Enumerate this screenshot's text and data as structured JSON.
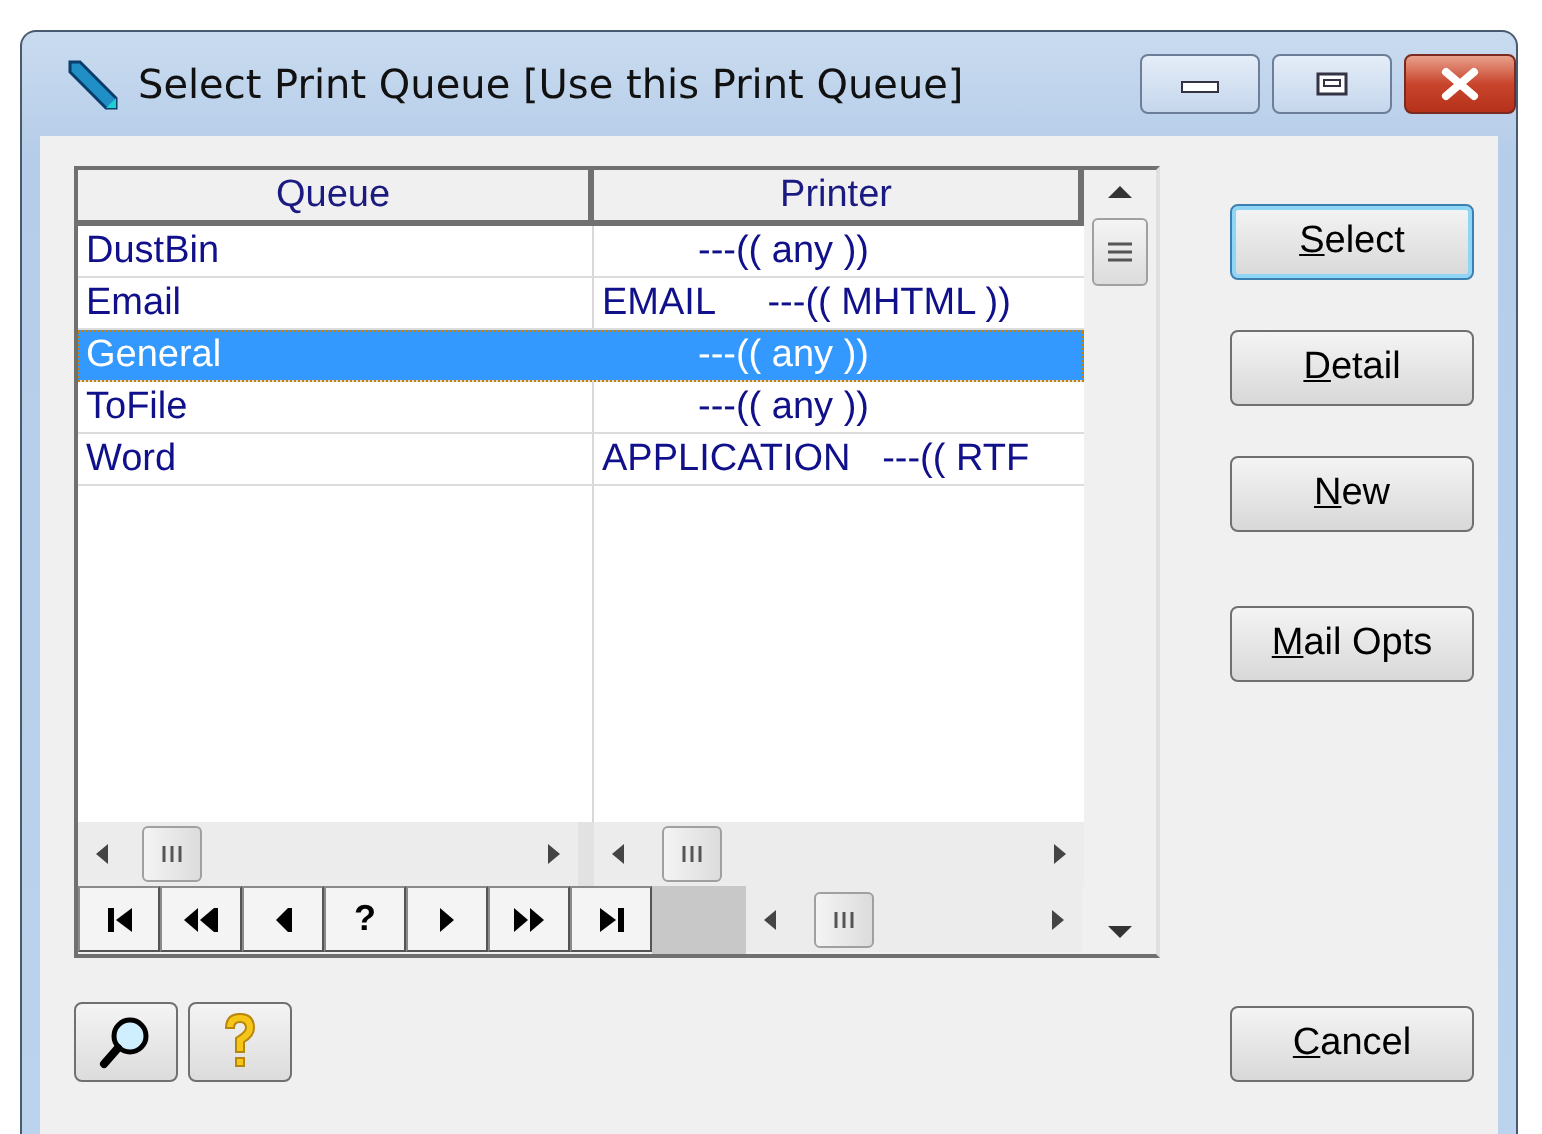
{
  "window": {
    "title": "Select Print Queue [Use this Print Queue]"
  },
  "table": {
    "columns": [
      "Queue",
      "Printer"
    ],
    "rows": [
      {
        "queue": "DustBin",
        "printer": "---(( any ))",
        "selected": false
      },
      {
        "queue": "Email",
        "printer": "EMAIL     ---(( MHTML ))",
        "selected": false
      },
      {
        "queue": "General",
        "printer": "---(( any ))",
        "selected": true
      },
      {
        "queue": "ToFile",
        "printer": "---(( any ))",
        "selected": false
      },
      {
        "queue": "Word",
        "printer": "APPLICATION   ---(( RTF",
        "selected": false
      }
    ]
  },
  "navigator": [
    {
      "kind": "first"
    },
    {
      "kind": "prev-page"
    },
    {
      "kind": "prev"
    },
    {
      "kind": "query",
      "label": "?"
    },
    {
      "kind": "next"
    },
    {
      "kind": "next-page"
    },
    {
      "kind": "last"
    }
  ],
  "buttons": [
    {
      "label": "Select",
      "default": true
    },
    {
      "label": "Detail",
      "default": false
    },
    {
      "label": "New",
      "default": false
    },
    {
      "label": "Mail Opts",
      "default": false
    }
  ],
  "cancel_button": {
    "label": "Cancel"
  }
}
